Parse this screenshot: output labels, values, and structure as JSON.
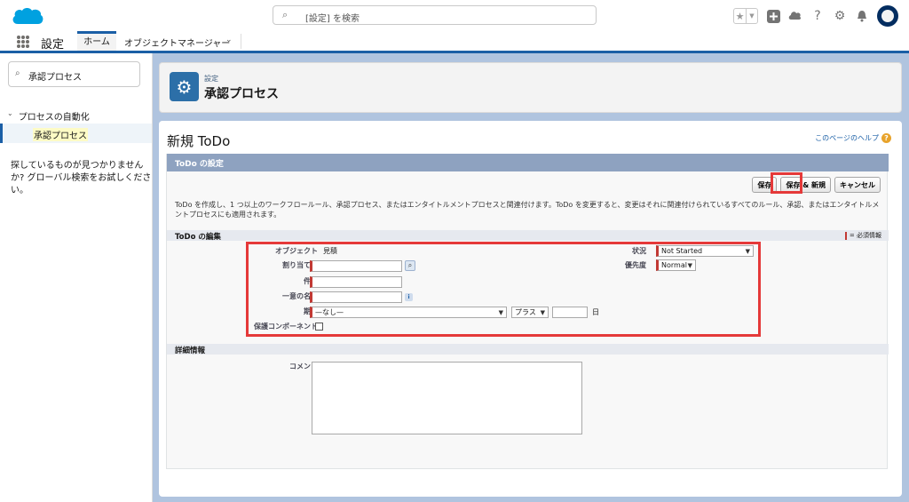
{
  "header": {
    "search_placeholder": "[設定] を検索",
    "icons": [
      "favorites-star-icon",
      "favorites-dropdown-icon",
      "global-actions-add-icon",
      "trailhead-icon",
      "help-icon",
      "setup-gear-icon",
      "notifications-bell-icon",
      "user-avatar-icon"
    ]
  },
  "appnav": {
    "app_name": "設定",
    "tabs": [
      "ホーム",
      "オブジェクトマネージャー"
    ]
  },
  "sidebar": {
    "quick_find_value": "承認プロセス",
    "tree_parent": "プロセスの自動化",
    "tree_child": "承認プロセス",
    "not_found_text": "探しているものが見つかりませんか? グローバル検索をお試しください。"
  },
  "page_header": {
    "breadcrumb": "設定",
    "title": "承認プロセス"
  },
  "content": {
    "title": "新規 ToDo",
    "help_link": "このページのヘルプ",
    "block_title": "ToDo の設定",
    "buttons": {
      "save": "保存",
      "save_new": "保存 & 新規",
      "cancel": "キャンセル"
    },
    "description": "ToDo を作成し、1 つ以上のワークフロールール、承認プロセス、またはエンタイトルメントプロセスと関連付けます。ToDo を変更すると、変更はそれに関連付けられているすべてのルール、承認、またはエンタイトルメントプロセスにも適用されます。",
    "edit_section": "ToDo の編集",
    "required_legend": "= 必須情報",
    "fields": {
      "object_label": "オブジェクト",
      "object_value": "見積",
      "assigned_label": "割り当て先",
      "subject_label": "件名",
      "unique_name_label": "一意の名前",
      "due_label": "期日",
      "due_select": "—なし—",
      "due_op": "プラス",
      "due_unit": "日",
      "protected_label": "保護コンポーネント",
      "status_label": "状況",
      "status_value": "Not Started",
      "priority_label": "優先度",
      "priority_value": "Normal"
    },
    "detail_section": "詳細情報",
    "comment_label": "コメント"
  },
  "colors": {
    "brand": "#1b5fa6",
    "highlight_red": "#e53939",
    "required_red": "#c23934",
    "block_header": "#8ea2c0"
  }
}
